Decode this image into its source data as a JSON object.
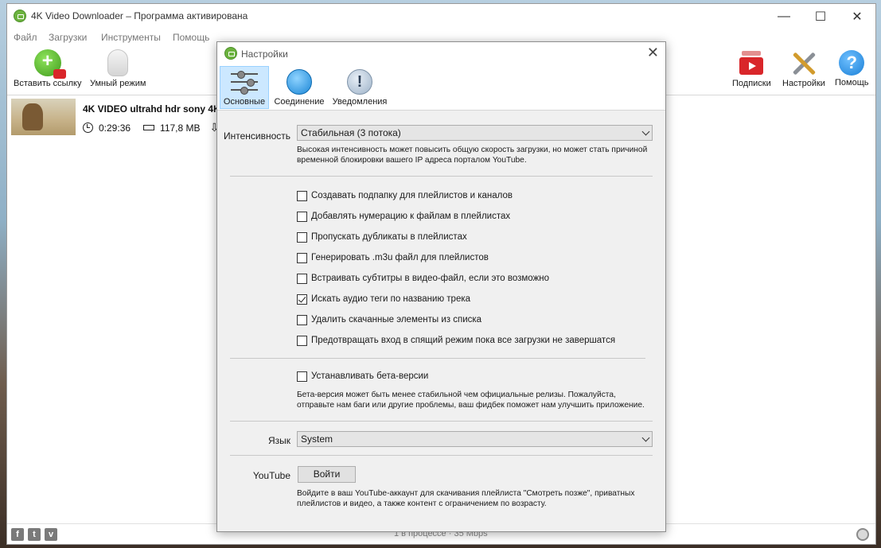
{
  "main": {
    "title": "4K Video Downloader – Программа активирована",
    "menu": [
      "Файл",
      "Загрузки",
      "Инструменты",
      "Помощь"
    ],
    "toolbar": {
      "paste": "Вставить ссылку",
      "smart": "Умный режим",
      "subscriptions": "Подписки",
      "settings": "Настройки",
      "help": "Помощь"
    },
    "download": {
      "title": "4K VIDEO ultrahd hdr sony 4K",
      "duration": "0:29:36",
      "size": "117,8 MB"
    },
    "status": "1 в процессе · 35 Mbps",
    "social": [
      "f",
      "t",
      "v"
    ]
  },
  "dialog": {
    "title": "Настройки",
    "tabs": [
      "Основные",
      "Соединение",
      "Уведомления"
    ],
    "intensity_label": "Интенсивность",
    "intensity_value": "Стабильная (3 потока)",
    "intensity_note": "Высокая интенсивность может повысить общую скорость загрузки, но может стать причиной временной блокировки вашего IP адреса порталом YouTube.",
    "options": [
      {
        "label": "Создавать подпапку для плейлистов и каналов",
        "checked": false
      },
      {
        "label": "Добавлять нумерацию к файлам в плейлистах",
        "checked": false
      },
      {
        "label": "Пропускать дубликаты в плейлистах",
        "checked": false
      },
      {
        "label": "Генерировать .m3u файл для плейлистов",
        "checked": false
      },
      {
        "label": "Встраивать субтитры в видео-файл, если это возможно",
        "checked": false
      },
      {
        "label": "Искать аудио теги по названию трека",
        "checked": true
      },
      {
        "label": "Удалить скачанные элементы из списка",
        "checked": false
      },
      {
        "label": "Предотвращать вход в спящий режим пока все загрузки не завершатся",
        "checked": false
      }
    ],
    "beta": {
      "label": "Устанавливать бета-версии",
      "checked": false
    },
    "beta_note": "Бета-версия может быть менее стабильной чем официальные релизы.  Пожалуйста, отправьте нам баги или другие проблемы, ваш фидбек поможет нам улучшить приложение.",
    "language_label": "Язык",
    "language_value": "System",
    "youtube_label": "YouTube",
    "login_button": "Войти",
    "youtube_note": "Войдите в ваш YouTube-аккаунт для скачивания плейлиста \"Смотреть позже\", приватных плейлистов и видео, а также контент с ограничением по возрасту."
  }
}
